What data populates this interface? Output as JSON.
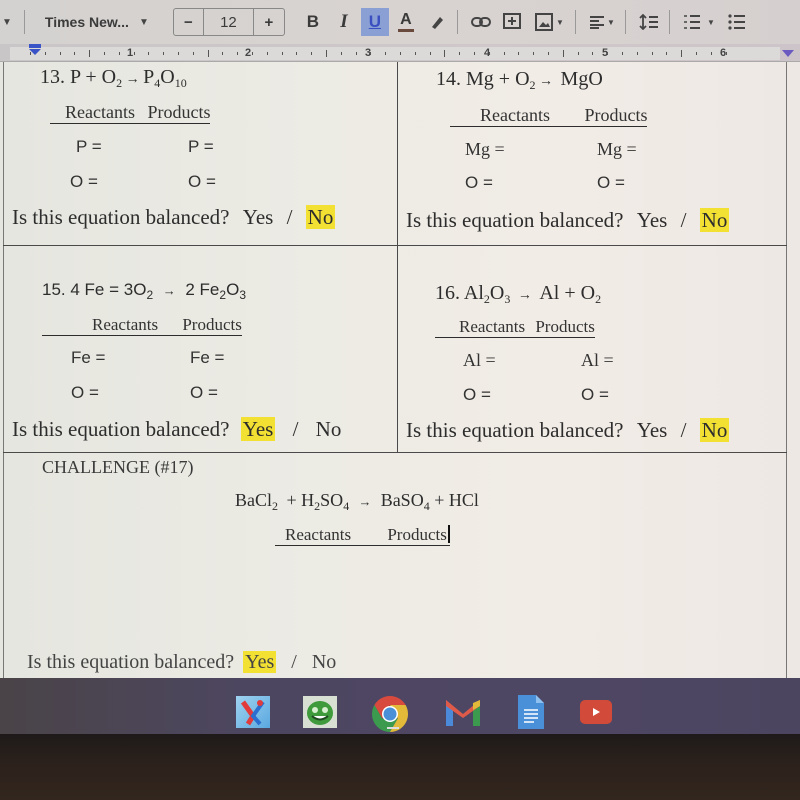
{
  "toolbar": {
    "font_name": "Times New...",
    "font_size": "12",
    "minus_label": "−",
    "plus_label": "+",
    "bold_label": "B",
    "italic_label": "I",
    "underline_label": "U",
    "text_color_label": "A",
    "icons": [
      "highlighter-icon",
      "link-icon",
      "add-comment-icon",
      "insert-image-icon",
      "align-icon",
      "line-spacing-icon",
      "numbered-list-icon",
      "bulleted-list-icon"
    ]
  },
  "ruler": {
    "numbers": [
      "1",
      "2",
      "3",
      "4",
      "5",
      "6"
    ]
  },
  "document": {
    "balanced_question": "Is this equation balanced?",
    "yes": "Yes",
    "slash": "/",
    "no": "No",
    "reactants_label": "Reactants",
    "products_label": "Products",
    "problems": [
      {
        "number": "13.",
        "equation_parts": [
          "P",
          " + ",
          "O",
          "2",
          " → ",
          "P",
          "4",
          "O",
          "10"
        ],
        "rows": [
          [
            "P =",
            "P ="
          ],
          [
            "O =",
            "O ="
          ]
        ],
        "answer_highlight": "No"
      },
      {
        "number": "14.",
        "equation_parts": [
          "Mg",
          " + ",
          "O",
          "2",
          " → ",
          "MgO"
        ],
        "rows": [
          [
            "Mg =",
            "Mg ="
          ],
          [
            "O =",
            "O ="
          ]
        ],
        "answer_highlight": "No"
      },
      {
        "number": "15.",
        "equation_parts": [
          "4 Fe = 3O",
          "2",
          " → ",
          "2 Fe",
          "2",
          "O",
          "3"
        ],
        "rows": [
          [
            "Fe =",
            "Fe ="
          ],
          [
            "O =",
            "O ="
          ]
        ],
        "answer_highlight": "Yes"
      },
      {
        "number": "16.",
        "equation_parts": [
          "Al",
          "2",
          "O",
          "3",
          " → ",
          "Al + O",
          "2"
        ],
        "rows": [
          [
            "Al =",
            "Al ="
          ],
          [
            "O =",
            "O ="
          ]
        ],
        "answer_highlight": "No"
      }
    ],
    "challenge": {
      "title": "CHALLENGE (#17)",
      "equation_parts": [
        "BaCl",
        "2",
        " + H",
        "2",
        "SO",
        "4",
        " → ",
        "BaSO",
        "4",
        " + HCl"
      ],
      "answer_highlight": "Yes"
    }
  },
  "shelf": {
    "apps": [
      "classlink-app-icon",
      "alien-app-icon",
      "chrome-icon",
      "gmail-icon",
      "google-docs-icon",
      "youtube-icon"
    ]
  },
  "colors": {
    "highlight": "#f2e033",
    "underline_active": "#8aa0d4",
    "shelf": "#4e4764"
  }
}
